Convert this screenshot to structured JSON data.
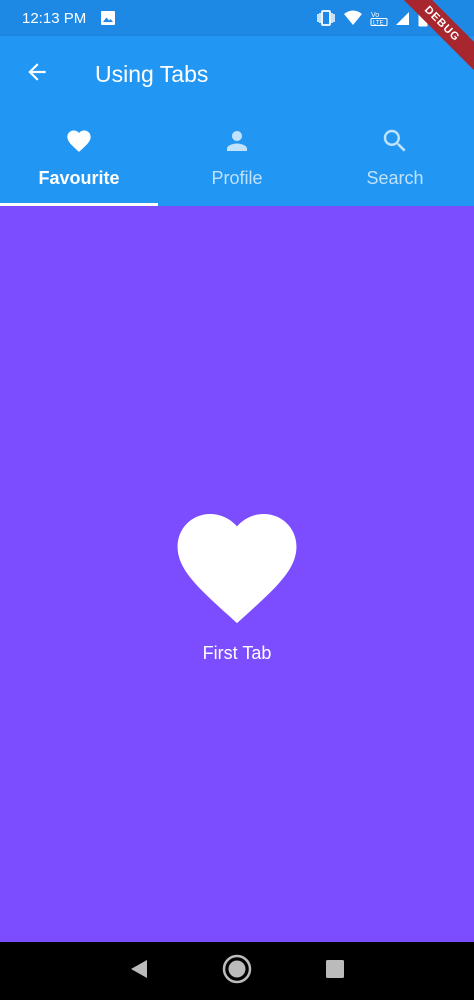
{
  "status_bar": {
    "time": "12:13 PM",
    "icons": [
      "image-icon",
      "vibrate-icon",
      "wifi-icon",
      "volte-icon",
      "signal-icon",
      "battery-icon"
    ]
  },
  "debug_banner": "DEBUG",
  "app_bar": {
    "title": "Using Tabs",
    "back_icon": "arrow-back-icon",
    "background": "#2196f3"
  },
  "tabs": [
    {
      "label": "Favourite",
      "icon": "heart-icon",
      "selected": true
    },
    {
      "label": "Profile",
      "icon": "person-icon",
      "selected": false
    },
    {
      "label": "Search",
      "icon": "search-icon",
      "selected": false
    }
  ],
  "content": {
    "icon": "heart-icon",
    "label": "First Tab",
    "background": "#7c4dff"
  },
  "nav_bar": {
    "buttons": [
      "back-triangle-icon",
      "home-circle-icon",
      "recents-square-icon"
    ]
  }
}
